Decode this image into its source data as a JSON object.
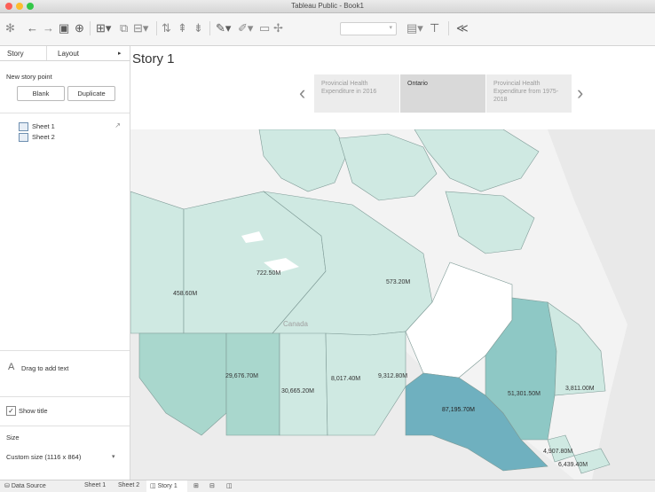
{
  "window": {
    "title": "Tableau Public - Book1"
  },
  "panel": {
    "tabs": [
      "Story",
      "Layout"
    ],
    "new_story_point_label": "New story point",
    "blank_label": "Blank",
    "duplicate_label": "Duplicate",
    "sheets": [
      "Sheet 1",
      "Sheet 2"
    ],
    "drag_text_label": "Drag to add text",
    "show_title_label": "Show title",
    "size_label": "Size",
    "size_value": "Custom size (1116 x 864)"
  },
  "story": {
    "title": "Story 1",
    "points": [
      {
        "label": "Provincial Health Expenditure in 2016",
        "active": false
      },
      {
        "label": "Ontario",
        "active": true
      },
      {
        "label": "Provincial Health Expenditure from 1975-2018",
        "active": false
      }
    ]
  },
  "map": {
    "country_label": "Canada",
    "values": {
      "yukon": "458.60M",
      "nwt": "722.50M",
      "nunavut": "573.20M",
      "bc": "29,676.70M",
      "alberta": "30,665.20M",
      "saskatchewan": "8,017.40M",
      "manitoba": "9,312.80M",
      "ontario": "87,195.70M",
      "quebec": "51,301.50M",
      "newfoundland": "3,811.00M",
      "new_brunswick": "4,907.80M",
      "nova_scotia": "6,439.40M"
    },
    "colors": {
      "low": "#cfe9e2",
      "mid": "#a9d7cd",
      "high": "#8ec8c5",
      "highest": "#6fb0bf",
      "border": "#7e9a96",
      "land": "#e8e8e8",
      "water": "#ffffff"
    }
  },
  "bottom": {
    "data_source": "Data Source",
    "tabs": [
      "Sheet 1",
      "Sheet 2",
      "Story 1"
    ]
  }
}
